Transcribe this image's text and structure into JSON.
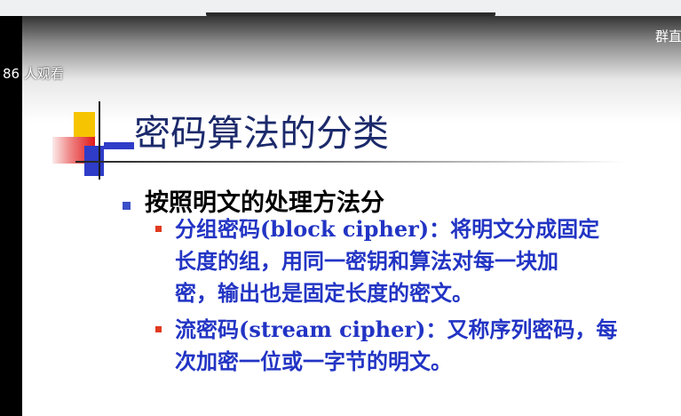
{
  "overlay": {
    "viewer_count": "86 人观看",
    "group_label": "群直"
  },
  "slide": {
    "title": "密码算法的分类",
    "level1": "按照明文的处理方法分",
    "items": [
      {
        "term": "分组密码",
        "term_en": "(block cipher)",
        "lines": [
          "：将明文分成固定",
          "长度的组，用同一密钥和算法对每一块加",
          "密，输出也是固定长度的密文。"
        ]
      },
      {
        "term": "流密码",
        "term_en": "(stream cipher)",
        "lines": [
          "：又称序列密码，每",
          "次加密一位或一字节的明文。"
        ]
      }
    ]
  },
  "colors": {
    "title": "#1c2a6b",
    "level2_text": "#2234c4",
    "bullet_level1": "#3a4fc8",
    "bullet_level2": "#e03a1e"
  }
}
